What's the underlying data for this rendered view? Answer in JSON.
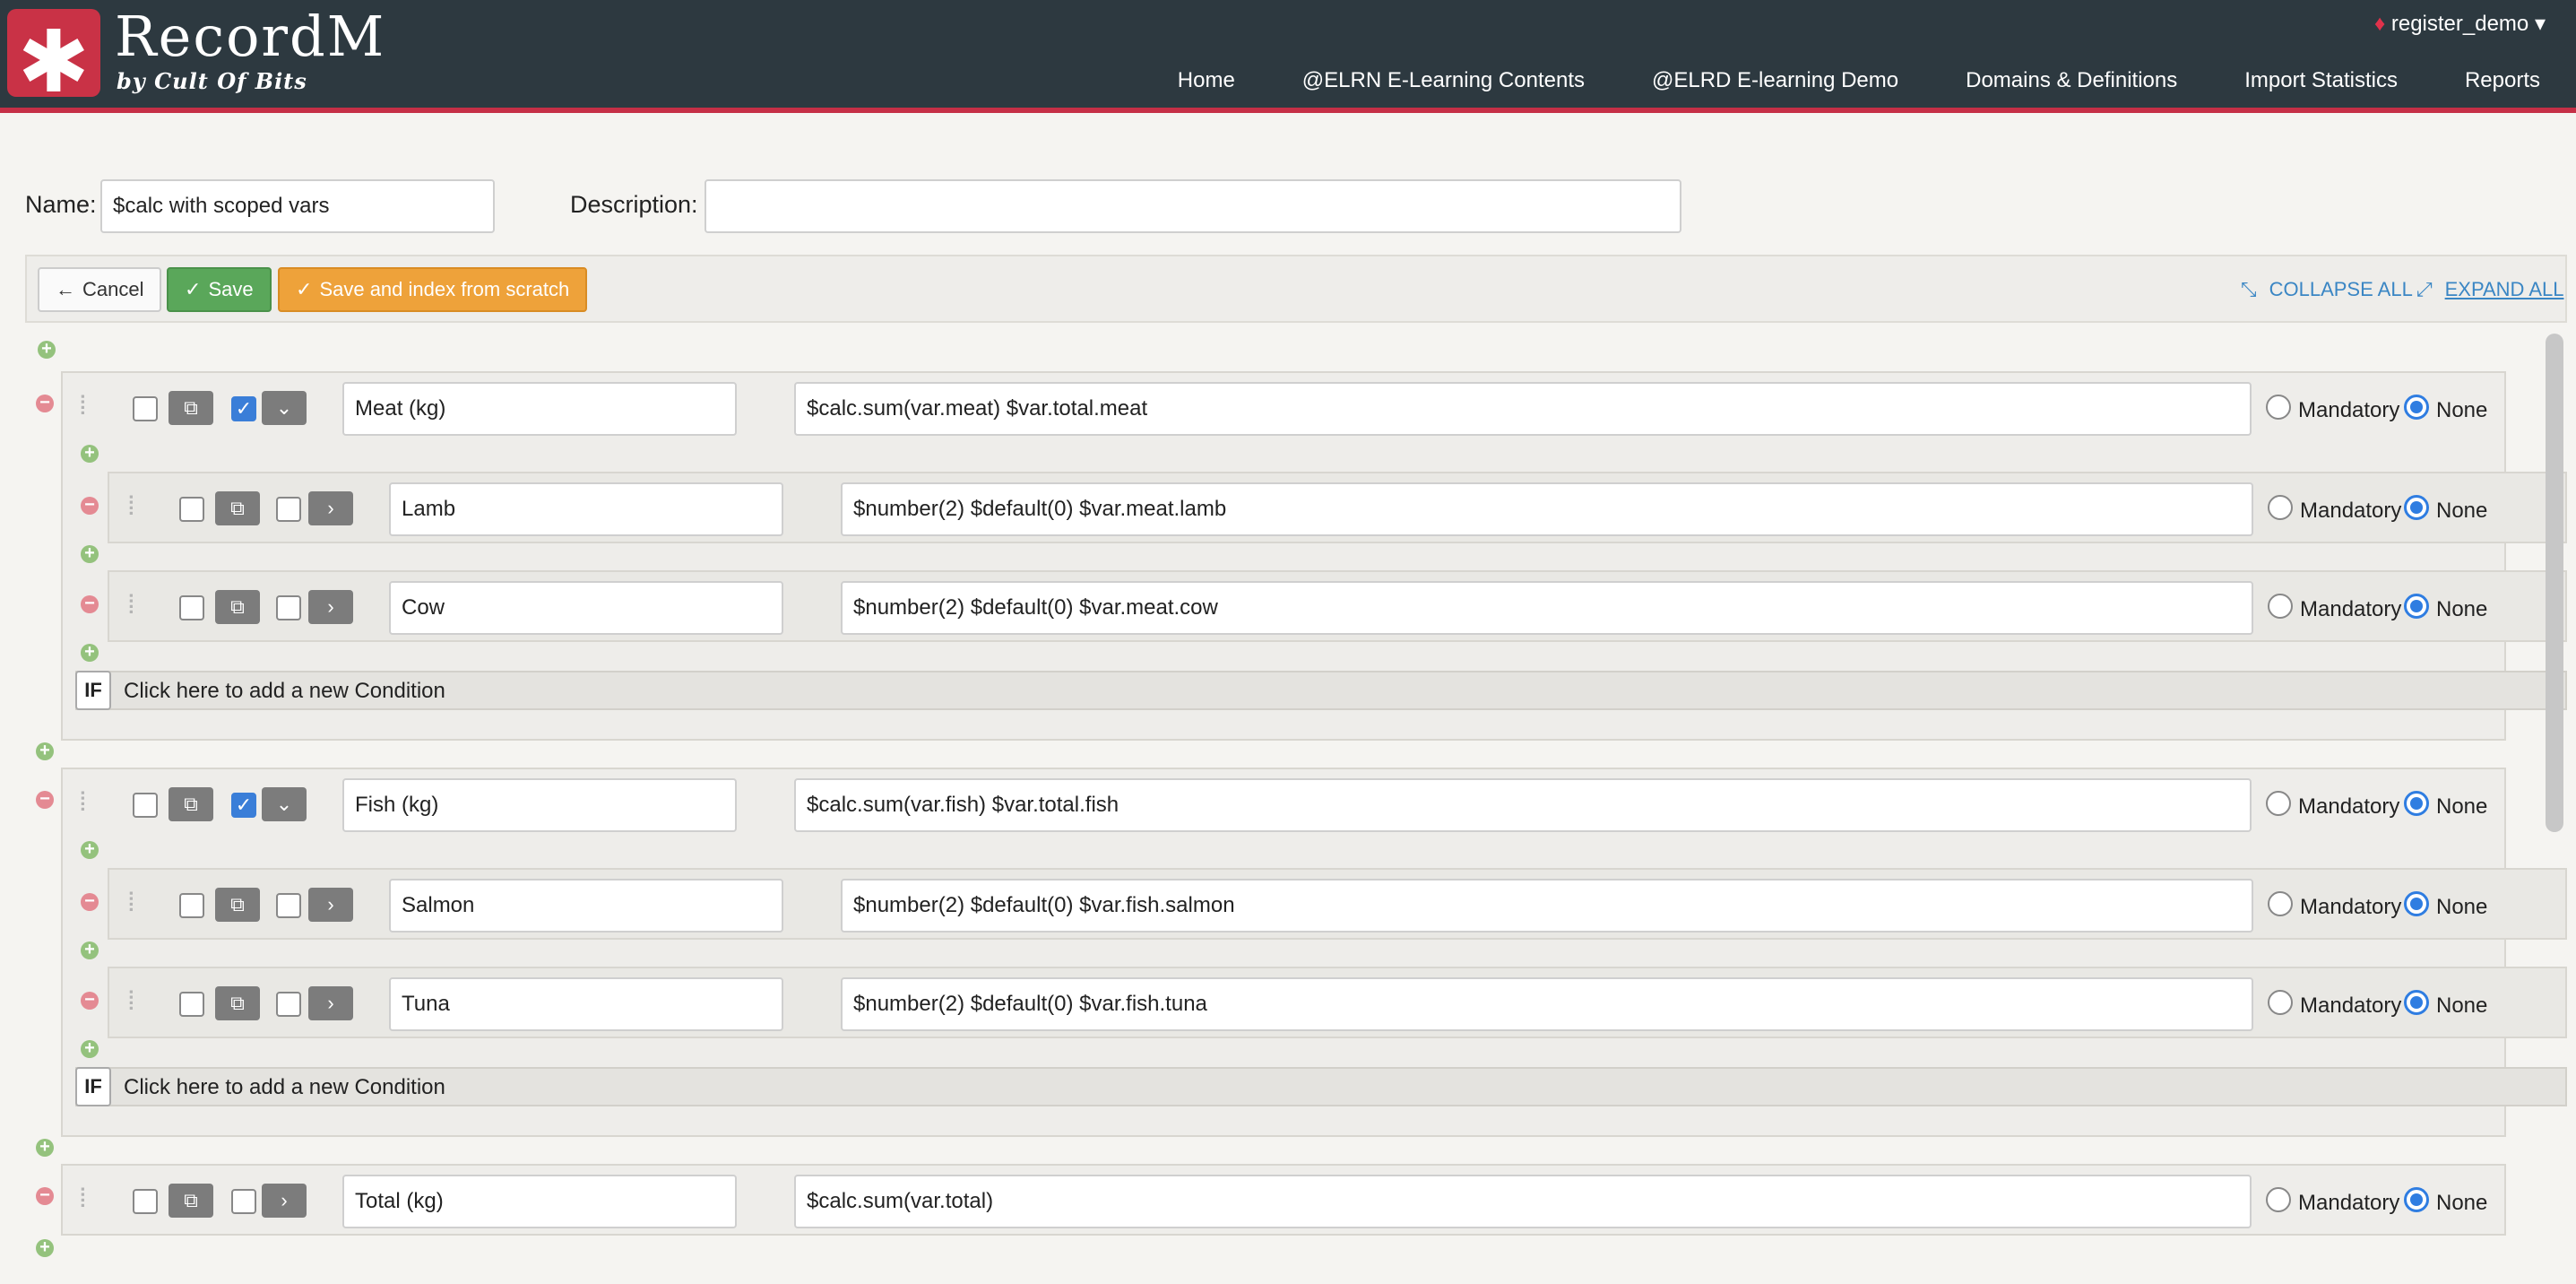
{
  "header": {
    "logo_symbol": "✱",
    "app_title": "RecordM",
    "app_subtitle": "by Cult Of Bits",
    "user": "register_demo",
    "nav": [
      "Home",
      "@ELRN E-Learning Contents",
      "@ELRD E-learning Demo",
      "Domains & Definitions",
      "Import Statistics",
      "Reports"
    ]
  },
  "form": {
    "name_label": "Name:",
    "name_value": "$calc with scoped vars",
    "description_label": "Description:",
    "description_value": ""
  },
  "toolbar": {
    "cancel_label": "Cancel",
    "save_label": "Save",
    "save_index_label": "Save and index from scratch",
    "collapse_all": "COLLAPSE ALL",
    "expand_all": "EXPAND ALL"
  },
  "fields": {
    "meat": {
      "name": "Meat (kg)",
      "description": "$calc.sum(var.meat) $var.total.meat",
      "required": "None"
    },
    "lamb": {
      "name": "Lamb",
      "description": "$number(2) $default(0) $var.meat.lamb",
      "required": "None"
    },
    "cow": {
      "name": "Cow",
      "description": "$number(2) $default(0) $var.meat.cow",
      "required": "None"
    },
    "fish": {
      "name": "Fish (kg)",
      "description": "$calc.sum(var.fish) $var.total.fish",
      "required": "None"
    },
    "salmon": {
      "name": "Salmon",
      "description": "$number(2) $default(0) $var.fish.salmon",
      "required": "None"
    },
    "tuna": {
      "name": "Tuna",
      "description": "$number(2) $default(0) $var.fish.tuna",
      "required": "None"
    },
    "total": {
      "name": "Total (kg)",
      "description": "$calc.sum(var.total)",
      "required": "None"
    }
  },
  "radio_labels": {
    "mandatory": "Mandatory",
    "none": "None"
  },
  "condition": {
    "if_label": "IF",
    "add_text": "Click here to add a new Condition"
  },
  "colors": {
    "header_bg": "#2d3940",
    "brand_red": "#c93246",
    "save_green": "#5aa75a",
    "index_orange": "#eea23a",
    "link_blue": "#3a86c4",
    "radio_blue": "#2f7de1"
  }
}
